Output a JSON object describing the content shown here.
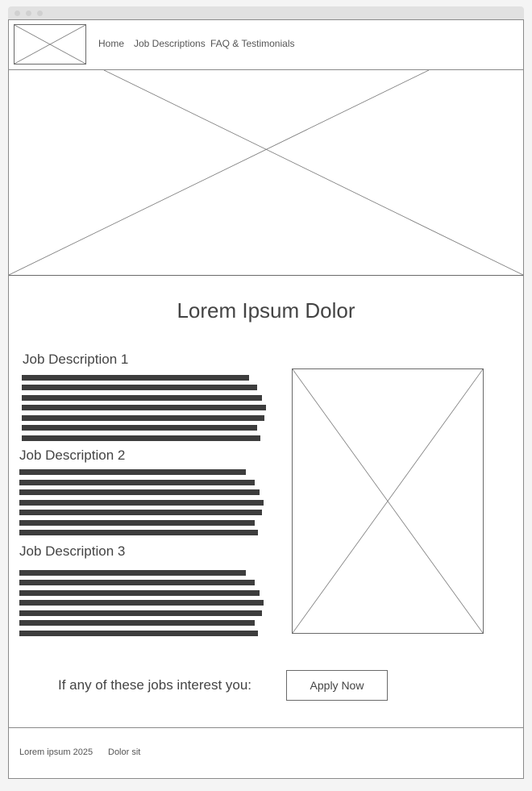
{
  "header": {
    "nav": [
      "Home",
      "Job Descriptions",
      "FAQ & Testimonials"
    ]
  },
  "main": {
    "headline": "Lorem Ipsum Dolor",
    "jobs": [
      {
        "title": "Job Description 1"
      },
      {
        "title": "Job Description 2"
      },
      {
        "title": "Job Description 3"
      }
    ],
    "cta_text": "If any of these jobs interest you:",
    "apply_label": "Apply Now"
  },
  "footer": {
    "copyright": "Lorem ipsum 2025",
    "link": "Dolor sit"
  },
  "colors": {
    "frame": "#8a8a8a",
    "text_bar": "#3d3d3d",
    "titlebar": "#e1e1e1"
  }
}
